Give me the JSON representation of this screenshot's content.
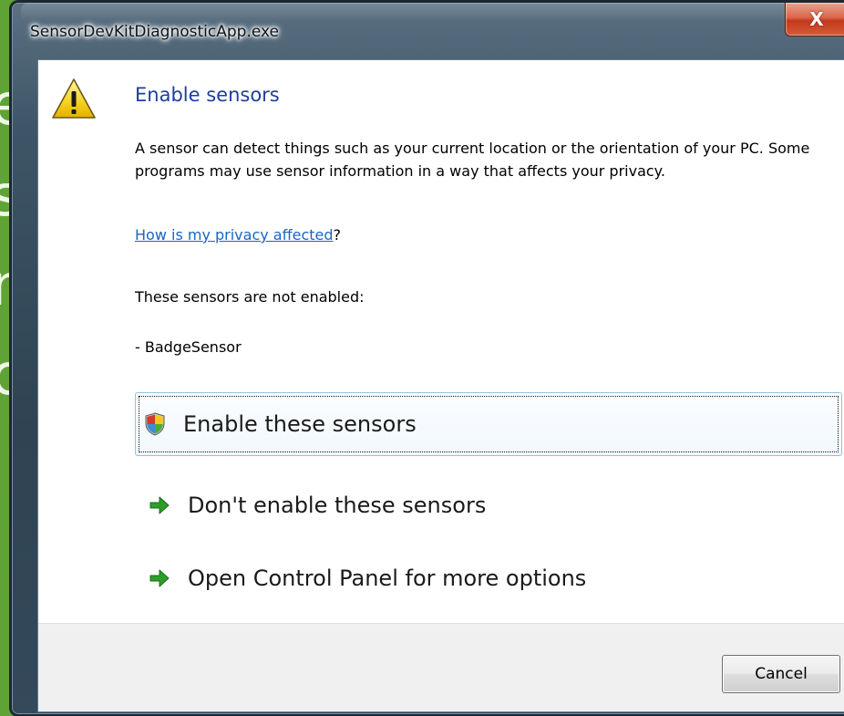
{
  "window": {
    "title": "SensorDevKitDiagnosticApp.exe",
    "close_glyph": "X"
  },
  "background": {
    "fragments": [
      "e",
      "s",
      "n",
      "c"
    ],
    "color": "#5fa336"
  },
  "dialog": {
    "heading": "Enable sensors",
    "description": "A sensor can detect things such as your current location or the orientation of your PC. Some programs may use sensor information in a way that affects your privacy.",
    "privacy_link": "How is my privacy affected",
    "privacy_suffix": "?",
    "not_enabled_text": "These sensors are not enabled:",
    "sensor_item": "- BadgeSensor",
    "commands": {
      "enable": "Enable these sensors",
      "dont_enable": "Don't enable these sensors",
      "control_panel": "Open Control Panel for more options"
    },
    "cancel_label": "Cancel"
  },
  "icons": {
    "warning": "warning-triangle-icon",
    "shield": "uac-shield-icon",
    "arrow": "green-arrow-icon"
  },
  "colors": {
    "heading": "#1e3e9c",
    "link": "#1a64c8",
    "arrow": "#2e9d2a"
  }
}
